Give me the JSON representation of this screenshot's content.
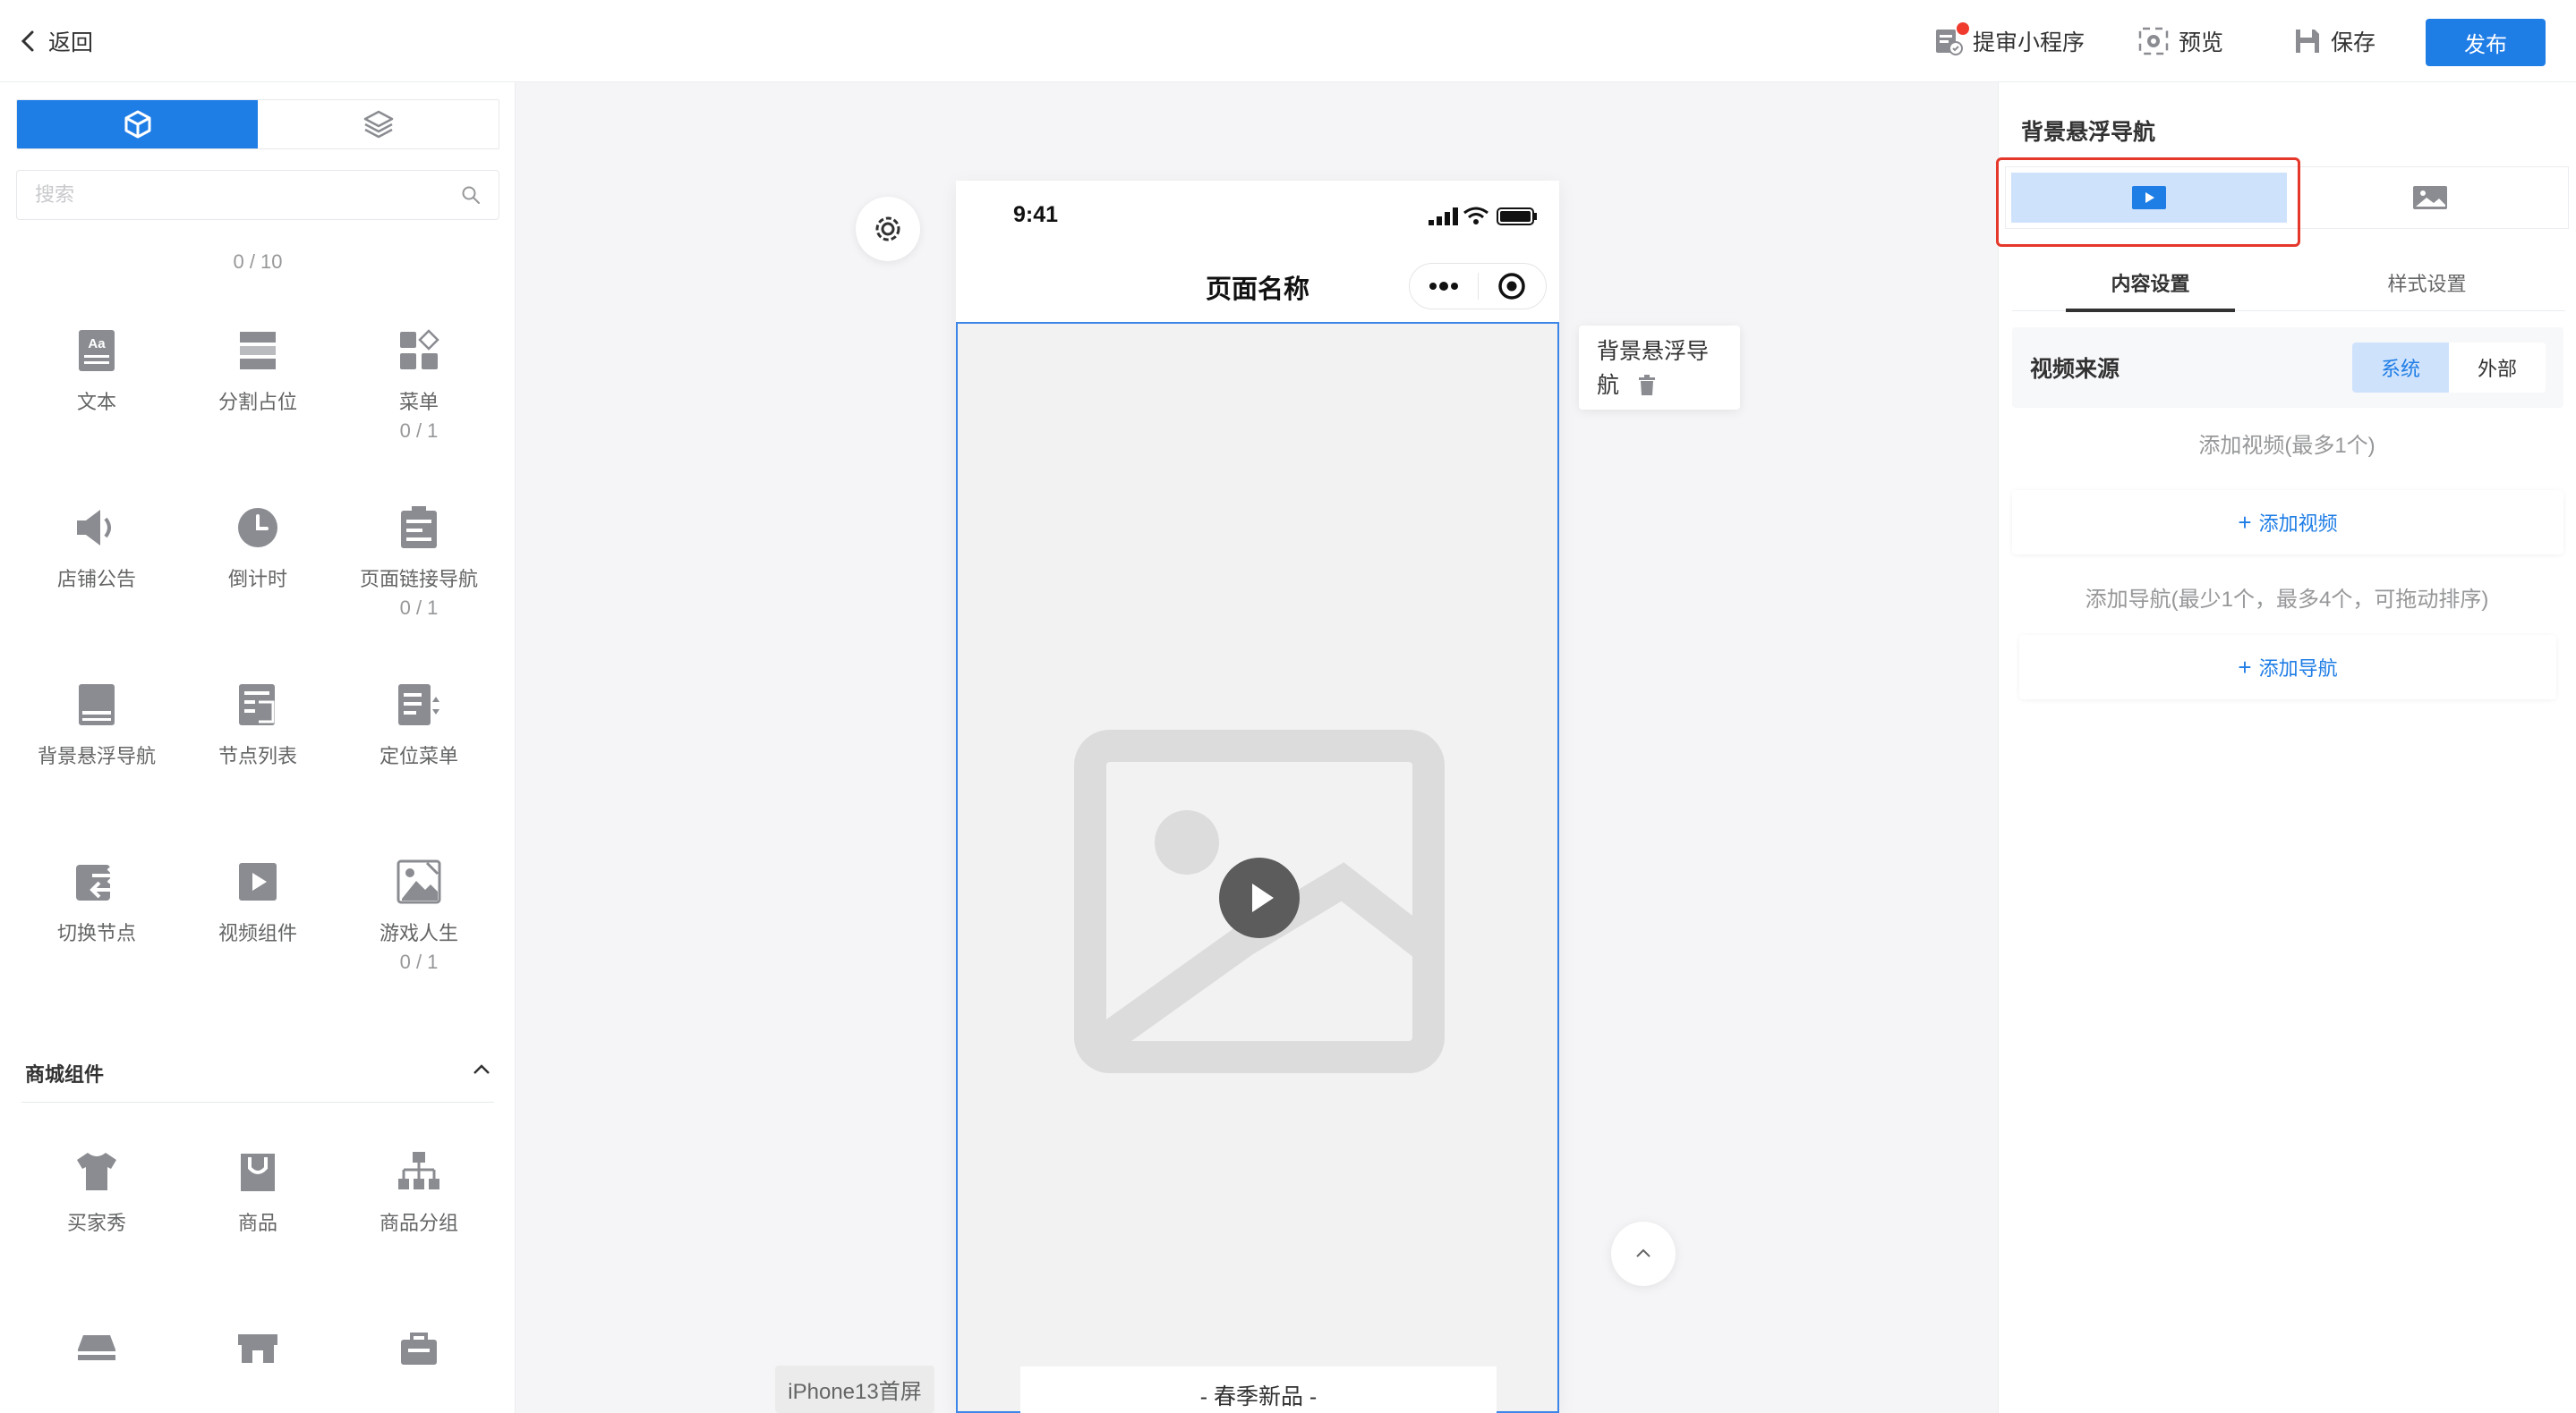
{
  "topbar": {
    "back_label": "返回",
    "submit_label": "提审小程序",
    "preview_label": "预览",
    "save_label": "保存",
    "publish_label": "发布"
  },
  "left_panel": {
    "search_placeholder": "搜索",
    "counter": "0 / 10",
    "components": [
      {
        "label": "文本",
        "sub": "",
        "icon": "text-icon"
      },
      {
        "label": "分割占位",
        "sub": "",
        "icon": "divider-icon"
      },
      {
        "label": "菜单",
        "sub": "0 / 1",
        "icon": "menu-grid-icon"
      },
      {
        "label": "店铺公告",
        "sub": "",
        "icon": "speaker-icon"
      },
      {
        "label": "倒计时",
        "sub": "",
        "icon": "clock-icon"
      },
      {
        "label": "页面链接导航",
        "sub": "0 / 1",
        "icon": "link-nav-icon"
      },
      {
        "label": "背景悬浮导航",
        "sub": "",
        "icon": "float-nav-icon"
      },
      {
        "label": "节点列表",
        "sub": "",
        "icon": "node-list-icon"
      },
      {
        "label": "定位菜单",
        "sub": "",
        "icon": "locate-menu-icon"
      },
      {
        "label": "切换节点",
        "sub": "",
        "icon": "switch-node-icon"
      },
      {
        "label": "视频组件",
        "sub": "",
        "icon": "video-icon"
      },
      {
        "label": "游戏人生",
        "sub": "0 / 1",
        "icon": "game-image-icon"
      }
    ],
    "mall_section_title": "商城组件",
    "mall_components": [
      {
        "label": "买家秀",
        "icon": "tshirt-icon"
      },
      {
        "label": "商品",
        "icon": "bag-icon"
      },
      {
        "label": "商品分组",
        "icon": "hierarchy-icon"
      }
    ]
  },
  "canvas": {
    "status_time": "9:41",
    "page_title": "页面名称",
    "float_label": "背景悬浮导航",
    "spring_text": "- 春季新品 -",
    "device_tag": "iPhone13首屏"
  },
  "right_panel": {
    "title": "背景悬浮导航",
    "tab_content": "内容设置",
    "tab_style": "样式设置",
    "video_source_label": "视频来源",
    "source_system": "系统",
    "source_external": "外部",
    "add_video_hint": "添加视频(最多1个)",
    "add_video_label": "添加视频",
    "add_nav_hint": "添加导航(最少1个，最多4个，可拖动排序)",
    "add_nav_label": "添加导航"
  },
  "colors": {
    "accent": "#1f7de6",
    "highlight": "#cfe2fb",
    "alert_red": "#e5372a",
    "selection_blue": "#3c86e8"
  }
}
